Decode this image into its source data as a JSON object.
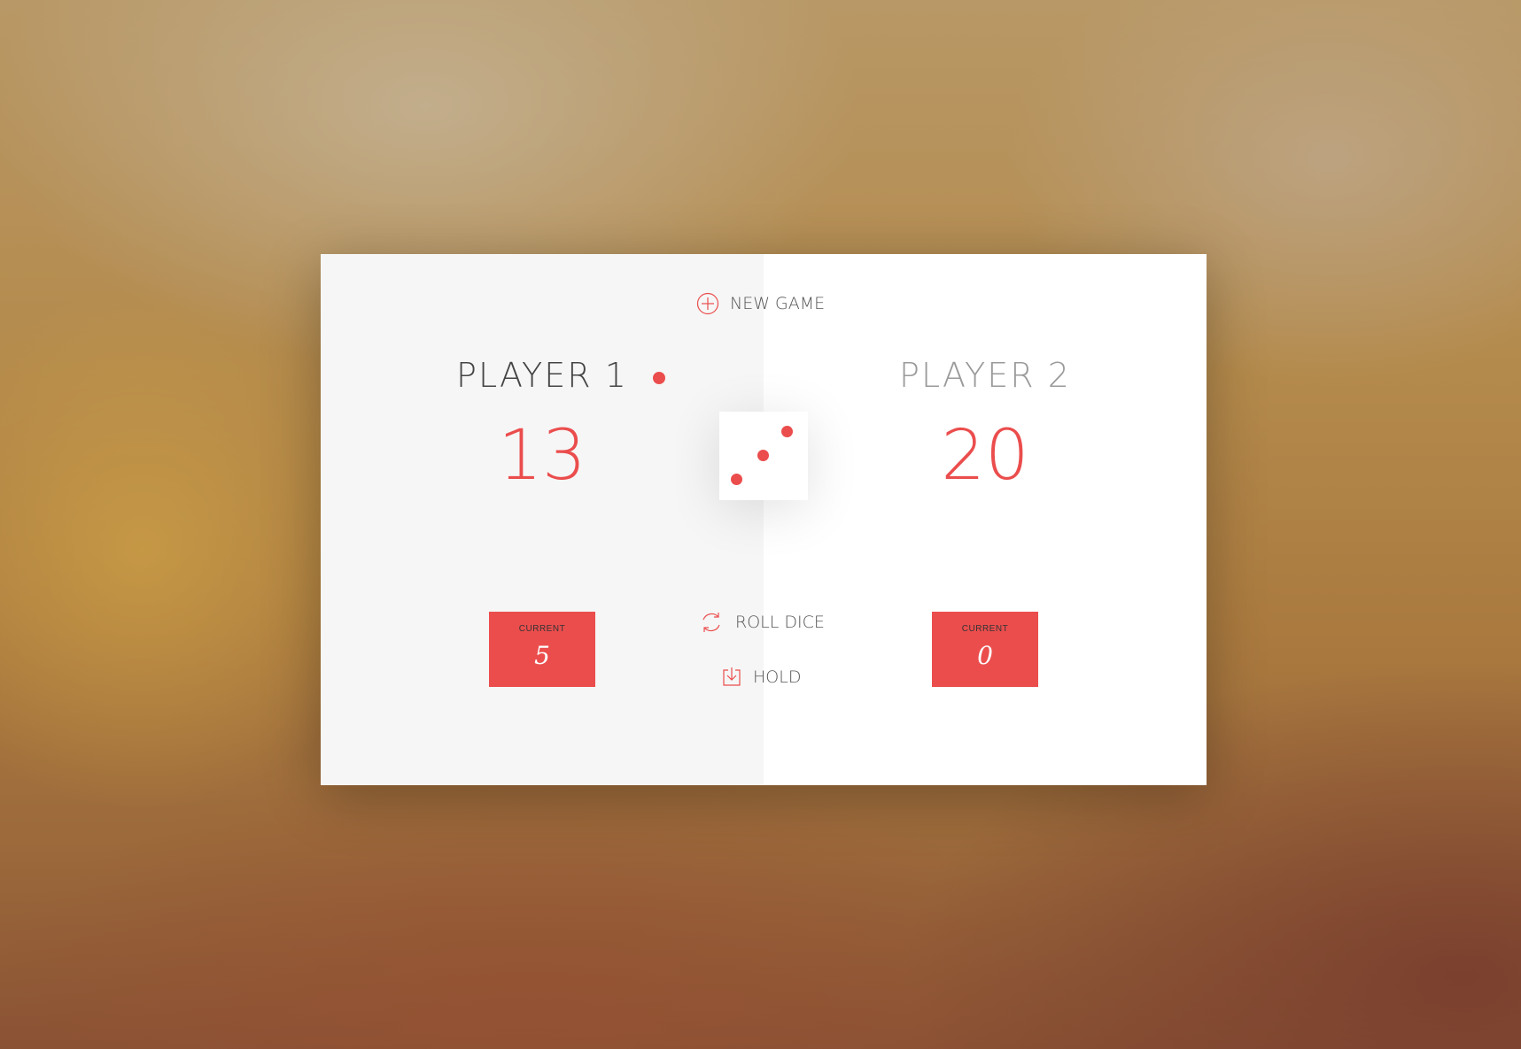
{
  "controls": {
    "new_game": {
      "label": "NEW GAME",
      "icon": "plus-circle-icon"
    },
    "roll_dice": {
      "label": "ROLL DICE",
      "icon": "refresh-icon"
    },
    "hold": {
      "label": "HOLD",
      "icon": "download-icon"
    }
  },
  "players": [
    {
      "name": "PLAYER 1",
      "score": "13",
      "current_label": "CURRENT",
      "current_score": "5",
      "active": true
    },
    {
      "name": "PLAYER 2",
      "score": "20",
      "current_label": "CURRENT",
      "current_score": "0",
      "active": false
    }
  ],
  "dice": {
    "value": 3
  },
  "colors": {
    "accent": "#eb4d4d",
    "left_panel": "#f6f6f6",
    "right_panel": "#ffffff"
  }
}
